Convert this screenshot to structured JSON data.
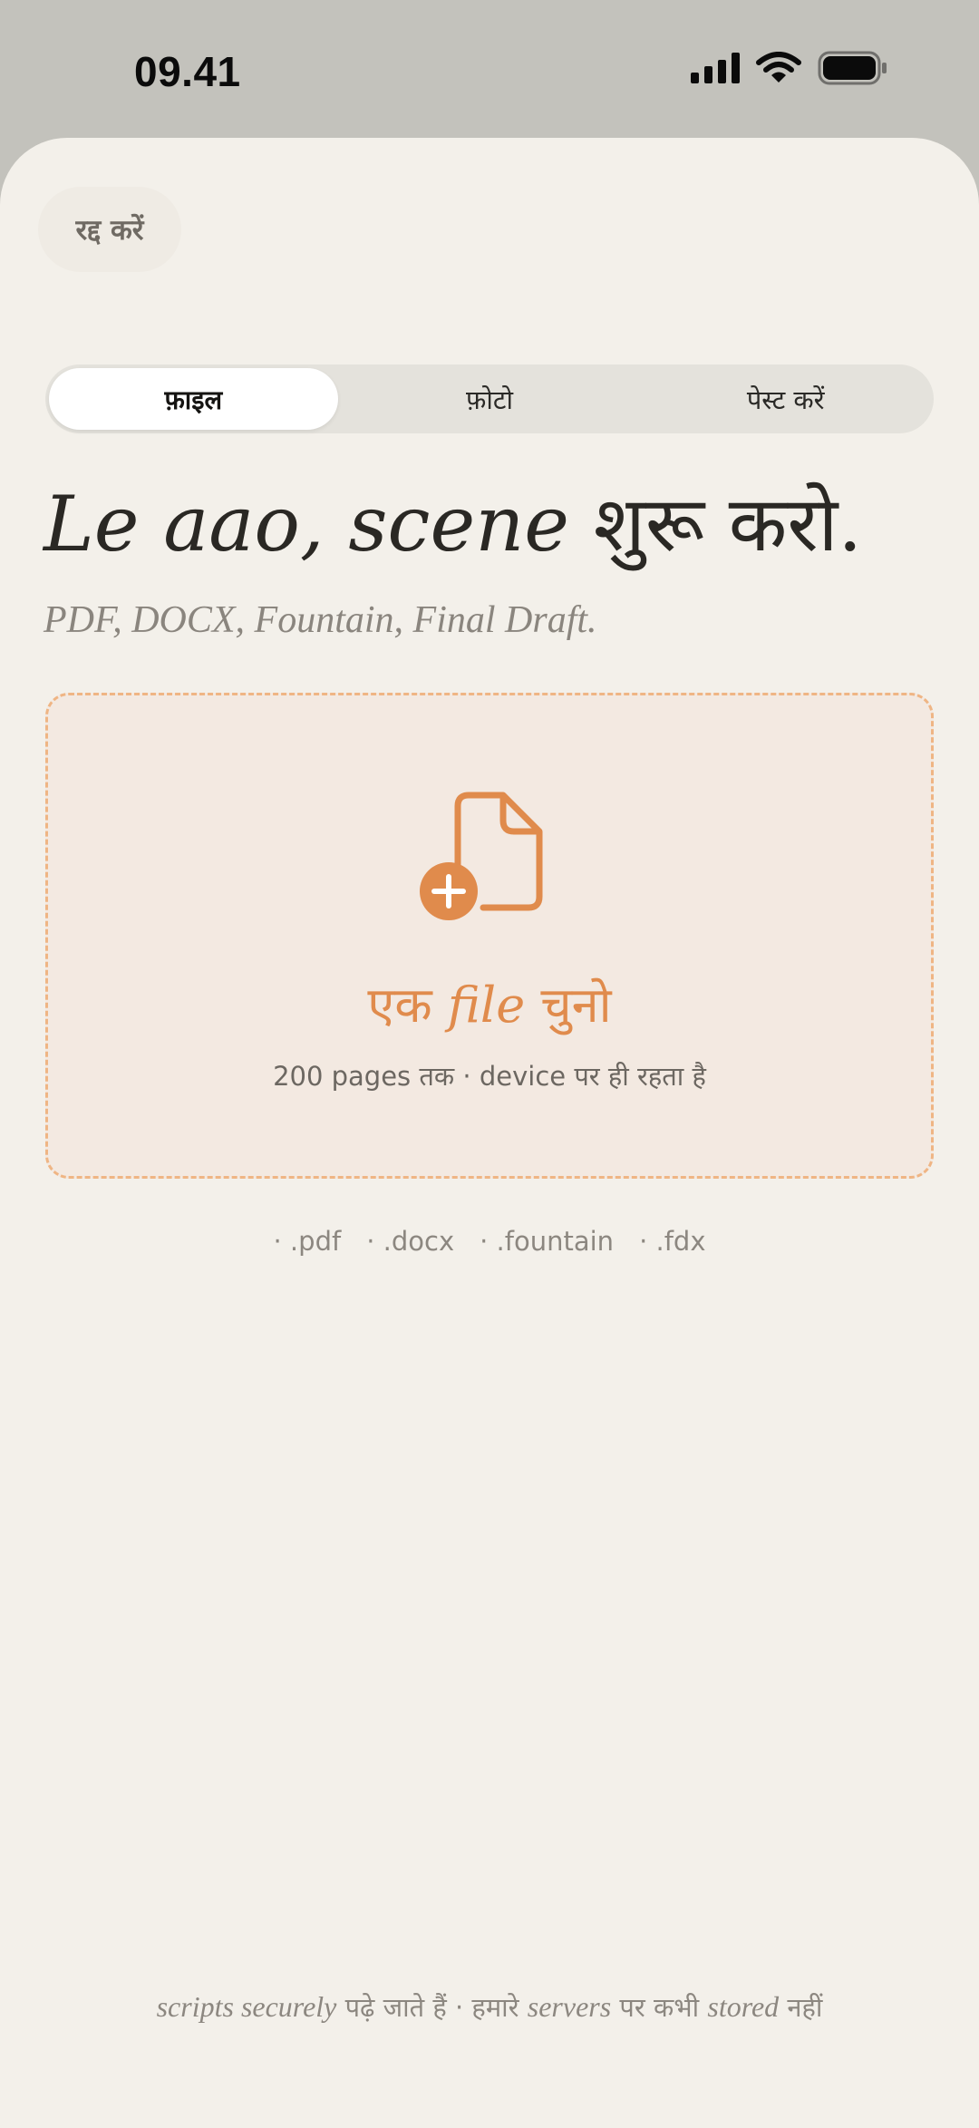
{
  "status_bar": {
    "time": "09.41"
  },
  "header": {
    "cancel_label": "रद्द करें"
  },
  "tabs": [
    {
      "label": "फ़ाइल",
      "active": true
    },
    {
      "label": "फ़ोटो",
      "active": false
    },
    {
      "label": "पेस्ट करें",
      "active": false
    }
  ],
  "headline": {
    "latin": "Le aao, scene",
    "hindi": " शुरू करो."
  },
  "subhead": "PDF, DOCX, Fountain, Final Draft.",
  "drop_zone": {
    "title_part1": "एक ",
    "title_latin": "file",
    "title_part2": " चुनो",
    "subtitle": "200 pages तक · device पर ही रहता है",
    "icon": "file-add-icon"
  },
  "formats": [
    "· .pdf",
    "· .docx",
    "· .fountain",
    "· .fdx"
  ],
  "footer": {
    "part1": "scripts securely",
    "part2": " पढ़े जाते हैं · हमारे ",
    "part3": "servers",
    "part4": " पर कभी ",
    "part5": "stored",
    "part6": " नहीं"
  },
  "colors": {
    "accent": "#e08b4c",
    "drop_border": "#efb584",
    "drop_bg": "#f3e9e1",
    "sheet_bg": "#f3f0ea"
  }
}
